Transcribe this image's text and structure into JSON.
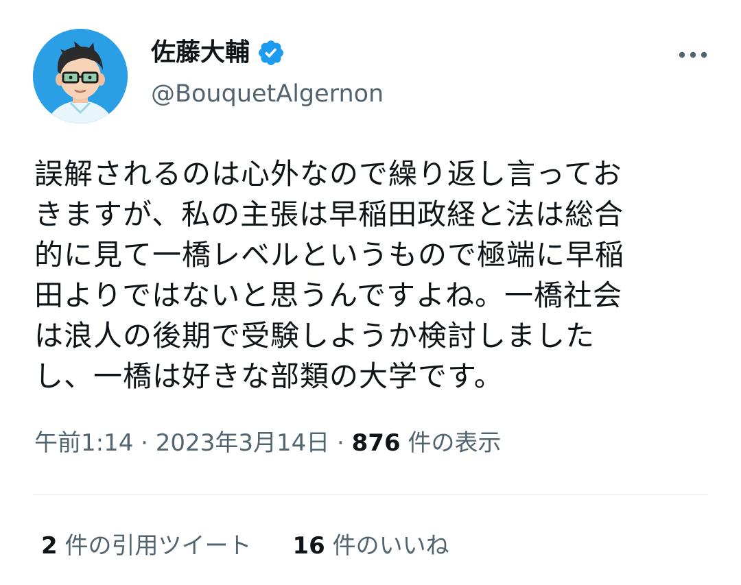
{
  "user": {
    "display_name": "佐藤大輔",
    "handle": "@BouquetAlgernon",
    "verified": true,
    "verified_color": "#1d9bf0"
  },
  "tweet": {
    "text": "誤解されるのは心外なので繰り返し言っておきますが、私の主張は早稲田政経と法は総合的に見て一橋レベルというもので極端に早稲田よりではないと思うんですよね。一橋社会は浪人の後期で受験しようか検討しましたし、一橋は好きな部類の大学です。",
    "lines": [
      "誤解されるのは心外なので繰り返し言ってお",
      "きますが、私の主張は早稲田政経と法は総合",
      "的に見て一橋レベルというもので極端に早稲",
      "田よりではないと思うんですよね。一橋社会",
      "は浪人の後期で受験しようか検討しました",
      "し、一橋は好きな部類の大学です。"
    ]
  },
  "meta": {
    "time": "午前1:14",
    "sep": "·",
    "date": "2023年3月14日",
    "views_count": "876",
    "views_label": "件の表示"
  },
  "stats": {
    "quotes_count": "2",
    "quotes_label": "件の引用ツイート",
    "likes_count": "16",
    "likes_label": "件のいいね"
  },
  "icons": {
    "more": "more-horizontal-icon",
    "verified": "verified-badge-icon"
  },
  "colors": {
    "text_primary": "#0f1419",
    "text_secondary": "#536471",
    "divider": "#eff3f4"
  }
}
